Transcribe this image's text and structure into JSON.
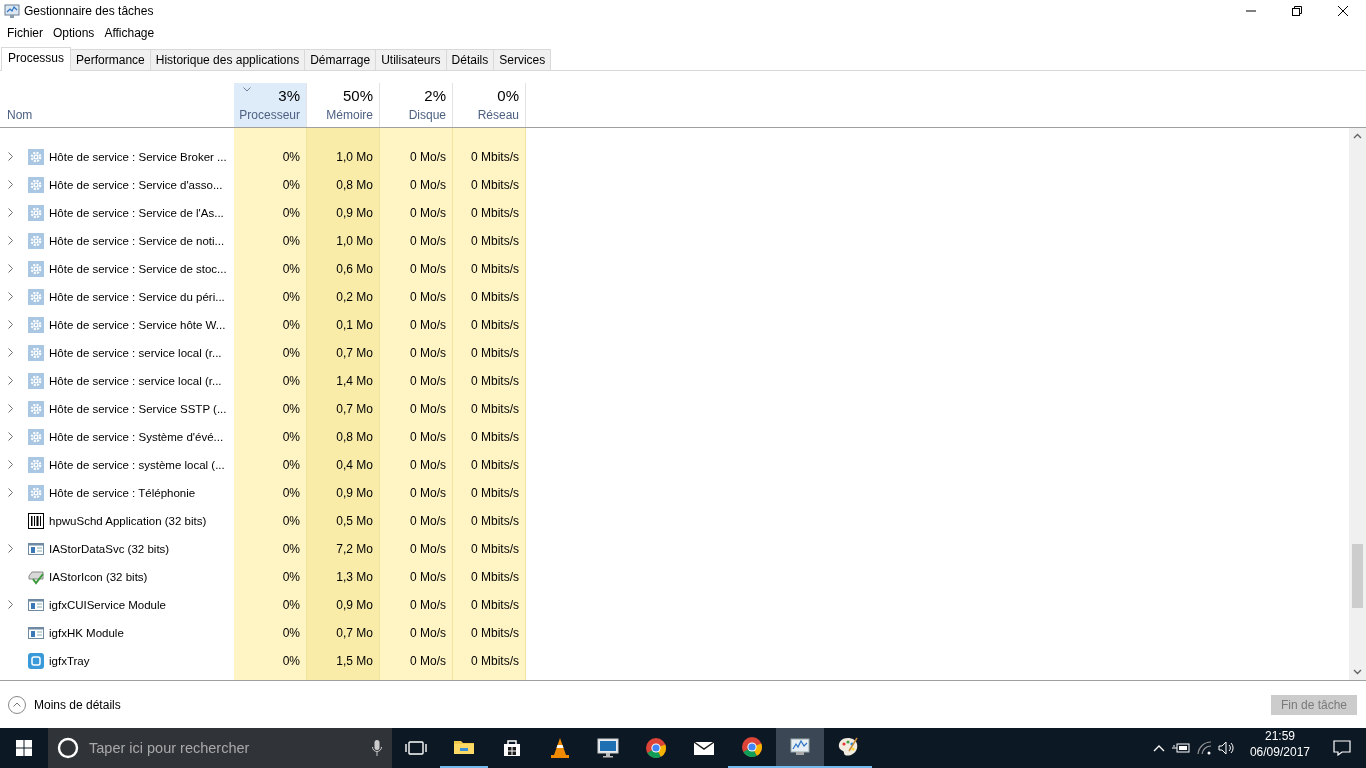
{
  "window": {
    "title": "Gestionnaire des tâches"
  },
  "menu": [
    "Fichier",
    "Options",
    "Affichage"
  ],
  "tabs": [
    {
      "label": "Processus",
      "selected": true
    },
    {
      "label": "Performance",
      "selected": false
    },
    {
      "label": "Historique des applications",
      "selected": false
    },
    {
      "label": "Démarrage",
      "selected": false
    },
    {
      "label": "Utilisateurs",
      "selected": false
    },
    {
      "label": "Détails",
      "selected": false
    },
    {
      "label": "Services",
      "selected": false
    }
  ],
  "table": {
    "name_column": "Nom",
    "columns": [
      {
        "total": "3%",
        "label": "Processeur",
        "sorted": true
      },
      {
        "total": "50%",
        "label": "Mémoire",
        "sorted": false
      },
      {
        "total": "2%",
        "label": "Disque",
        "sorted": false
      },
      {
        "total": "0%",
        "label": "Réseau",
        "sorted": false
      }
    ],
    "rows": [
      {
        "name": "Hôte de service : Service Broker ...",
        "kind": "gear",
        "expandable": true,
        "values": [
          "0%",
          "1,0 Mo",
          "0 Mo/s",
          "0 Mbits/s"
        ]
      },
      {
        "name": "Hôte de service : Service d'asso...",
        "kind": "gear",
        "expandable": true,
        "values": [
          "0%",
          "0,8 Mo",
          "0 Mo/s",
          "0 Mbits/s"
        ]
      },
      {
        "name": "Hôte de service : Service de l'As...",
        "kind": "gear",
        "expandable": true,
        "values": [
          "0%",
          "0,9 Mo",
          "0 Mo/s",
          "0 Mbits/s"
        ]
      },
      {
        "name": "Hôte de service : Service de noti...",
        "kind": "gear",
        "expandable": true,
        "values": [
          "0%",
          "1,0 Mo",
          "0 Mo/s",
          "0 Mbits/s"
        ]
      },
      {
        "name": "Hôte de service : Service de stoc...",
        "kind": "gear",
        "expandable": true,
        "values": [
          "0%",
          "0,6 Mo",
          "0 Mo/s",
          "0 Mbits/s"
        ]
      },
      {
        "name": "Hôte de service : Service du péri...",
        "kind": "gear",
        "expandable": true,
        "values": [
          "0%",
          "0,2 Mo",
          "0 Mo/s",
          "0 Mbits/s"
        ]
      },
      {
        "name": "Hôte de service : Service hôte W...",
        "kind": "gear",
        "expandable": true,
        "values": [
          "0%",
          "0,1 Mo",
          "0 Mo/s",
          "0 Mbits/s"
        ]
      },
      {
        "name": "Hôte de service : service local (r...",
        "kind": "gear",
        "expandable": true,
        "values": [
          "0%",
          "0,7 Mo",
          "0 Mo/s",
          "0 Mbits/s"
        ]
      },
      {
        "name": "Hôte de service : service local (r...",
        "kind": "gear",
        "expandable": true,
        "values": [
          "0%",
          "1,4 Mo",
          "0 Mo/s",
          "0 Mbits/s"
        ]
      },
      {
        "name": "Hôte de service : Service SSTP (...",
        "kind": "gear",
        "expandable": true,
        "values": [
          "0%",
          "0,7 Mo",
          "0 Mo/s",
          "0 Mbits/s"
        ]
      },
      {
        "name": "Hôte de service : Système d'évé...",
        "kind": "gear",
        "expandable": true,
        "values": [
          "0%",
          "0,8 Mo",
          "0 Mo/s",
          "0 Mbits/s"
        ]
      },
      {
        "name": "Hôte de service : système local (...",
        "kind": "gear",
        "expandable": true,
        "values": [
          "0%",
          "0,4 Mo",
          "0 Mo/s",
          "0 Mbits/s"
        ]
      },
      {
        "name": "Hôte de service : Téléphonie",
        "kind": "gear",
        "expandable": true,
        "values": [
          "0%",
          "0,9 Mo",
          "0 Mo/s",
          "0 Mbits/s"
        ]
      },
      {
        "name": "hpwuSchd Application (32 bits)",
        "kind": "barcode",
        "expandable": false,
        "values": [
          "0%",
          "0,5 Mo",
          "0 Mo/s",
          "0 Mbits/s"
        ]
      },
      {
        "name": "IAStorDataSvc (32 bits)",
        "kind": "window",
        "expandable": true,
        "values": [
          "0%",
          "7,2 Mo",
          "0 Mo/s",
          "0 Mbits/s"
        ]
      },
      {
        "name": "IAStorIcon (32 bits)",
        "kind": "drive",
        "expandable": false,
        "values": [
          "0%",
          "1,3 Mo",
          "0 Mo/s",
          "0 Mbits/s"
        ]
      },
      {
        "name": "igfxCUIService Module",
        "kind": "window",
        "expandable": true,
        "values": [
          "0%",
          "0,9 Mo",
          "0 Mo/s",
          "0 Mbits/s"
        ]
      },
      {
        "name": "igfxHK Module",
        "kind": "window",
        "expandable": false,
        "values": [
          "0%",
          "0,7 Mo",
          "0 Mo/s",
          "0 Mbits/s"
        ]
      },
      {
        "name": "igfxTray",
        "kind": "tray",
        "expandable": false,
        "values": [
          "0%",
          "1,5 Mo",
          "0 Mo/s",
          "0 Mbits/s"
        ]
      }
    ]
  },
  "footer": {
    "details_link": "Moins de détails",
    "end_task_button": {
      "label": "Fin de tâche",
      "disabled": true
    }
  },
  "taskbar": {
    "search_placeholder": "Taper ici pour rechercher",
    "apps": [
      {
        "kind": "folder",
        "running": true,
        "active": false
      },
      {
        "kind": "store",
        "running": false,
        "active": false
      },
      {
        "kind": "cone",
        "running": false,
        "active": false
      },
      {
        "kind": "monitor",
        "running": false,
        "active": false
      },
      {
        "kind": "browser",
        "running": false,
        "active": false
      },
      {
        "kind": "mail",
        "running": false,
        "active": false
      },
      {
        "kind": "browser",
        "running": true,
        "active": false
      },
      {
        "kind": "taskmgr",
        "running": true,
        "active": true
      },
      {
        "kind": "paint",
        "running": true,
        "active": false
      }
    ],
    "time": "21:59",
    "date": "06/09/2017"
  }
}
